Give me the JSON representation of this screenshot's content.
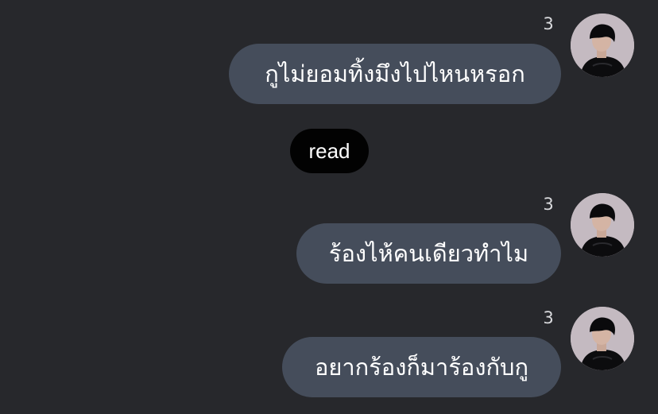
{
  "messages": [
    {
      "text": "กูไม่ยอมทิ้งมึงไปไหนหรอก",
      "count": "3"
    },
    {
      "text": "ร้องไห้คนเดียวทำไม",
      "count": "3"
    },
    {
      "text": "อยากร้องก็มาร้องกับกู",
      "count": "3"
    }
  ],
  "read_label": "read",
  "colors": {
    "background": "#27282c",
    "bubble": "#454d5b",
    "read_pill": "#020202",
    "text": "#ffffff",
    "count_text": "#d9dadd"
  },
  "icons": {
    "avatar": "user-avatar-photo"
  }
}
